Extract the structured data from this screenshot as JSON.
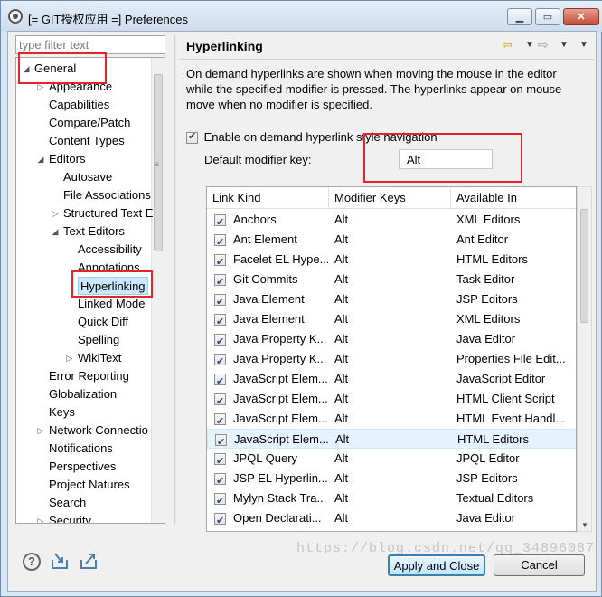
{
  "window": {
    "title": "[= GIT授权应用 =] Preferences"
  },
  "left": {
    "filter_placeholder": "type filter text",
    "tree": [
      {
        "label": "General",
        "level": 0,
        "twisty": "◢"
      },
      {
        "label": "Appearance",
        "level": 1,
        "twisty": "▷"
      },
      {
        "label": "Capabilities",
        "level": 1,
        "twisty": ""
      },
      {
        "label": "Compare/Patch",
        "level": 1,
        "twisty": ""
      },
      {
        "label": "Content Types",
        "level": 1,
        "twisty": ""
      },
      {
        "label": "Editors",
        "level": 1,
        "twisty": "◢"
      },
      {
        "label": "Autosave",
        "level": 2,
        "twisty": ""
      },
      {
        "label": "File Associations",
        "level": 2,
        "twisty": ""
      },
      {
        "label": "Structured Text E",
        "level": 2,
        "twisty": "▷"
      },
      {
        "label": "Text Editors",
        "level": 2,
        "twisty": "◢"
      },
      {
        "label": "Accessibility",
        "level": 3,
        "twisty": ""
      },
      {
        "label": "Annotations",
        "level": 3,
        "twisty": ""
      },
      {
        "label": "Hyperlinking",
        "level": 3,
        "twisty": "",
        "selected": true
      },
      {
        "label": "Linked Mode",
        "level": 3,
        "twisty": ""
      },
      {
        "label": "Quick Diff",
        "level": 3,
        "twisty": ""
      },
      {
        "label": "Spelling",
        "level": 3,
        "twisty": ""
      },
      {
        "label": "WikiText",
        "level": 3,
        "twisty": "▷"
      },
      {
        "label": "Error Reporting",
        "level": 1,
        "twisty": ""
      },
      {
        "label": "Globalization",
        "level": 1,
        "twisty": ""
      },
      {
        "label": "Keys",
        "level": 1,
        "twisty": ""
      },
      {
        "label": "Network Connectio",
        "level": 1,
        "twisty": "▷"
      },
      {
        "label": "Notifications",
        "level": 1,
        "twisty": ""
      },
      {
        "label": "Perspectives",
        "level": 1,
        "twisty": ""
      },
      {
        "label": "Project Natures",
        "level": 1,
        "twisty": ""
      },
      {
        "label": "Search",
        "level": 1,
        "twisty": ""
      },
      {
        "label": "Security",
        "level": 1,
        "twisty": "▷"
      }
    ]
  },
  "page": {
    "title": "Hyperlinking",
    "description": "On demand hyperlinks are shown when moving the mouse in the editor while the specified modifier is pressed. The hyperlinks appear on mouse move when no modifier is specified.",
    "enable_label": "Enable on demand hyperlink style navigation",
    "enable_checked": true,
    "modifier_label": "Default modifier key:",
    "modifier_value": "Alt",
    "columns": [
      "Link Kind",
      "Modifier Keys",
      "Available In"
    ],
    "rows": [
      {
        "kind": "Anchors",
        "mod": "Alt",
        "in": "XML Editors"
      },
      {
        "kind": "Ant Element",
        "mod": "Alt",
        "in": "Ant Editor"
      },
      {
        "kind": "Facelet EL Hype...",
        "mod": "Alt",
        "in": "HTML Editors"
      },
      {
        "kind": "Git Commits",
        "mod": "Alt",
        "in": "Task Editor"
      },
      {
        "kind": "Java Element",
        "mod": "Alt",
        "in": "JSP Editors"
      },
      {
        "kind": "Java Element",
        "mod": "Alt",
        "in": "XML Editors"
      },
      {
        "kind": "Java Property K...",
        "mod": "Alt",
        "in": "Java Editor"
      },
      {
        "kind": "Java Property K...",
        "mod": "Alt",
        "in": "Properties File Edit..."
      },
      {
        "kind": "JavaScript Elem...",
        "mod": "Alt",
        "in": "JavaScript Editor"
      },
      {
        "kind": "JavaScript Elem...",
        "mod": "Alt",
        "in": "HTML Client Script"
      },
      {
        "kind": "JavaScript Elem...",
        "mod": "Alt",
        "in": "HTML Event Handl..."
      },
      {
        "kind": "JavaScript Elem...",
        "mod": "Alt",
        "in": "HTML Editors",
        "selected": true
      },
      {
        "kind": "JPQL Query",
        "mod": "Alt",
        "in": "JPQL Editor"
      },
      {
        "kind": "JSP EL Hyperlin...",
        "mod": "Alt",
        "in": "JSP Editors"
      },
      {
        "kind": "Mylyn Stack Tra...",
        "mod": "Alt",
        "in": "Textual Editors"
      },
      {
        "kind": "Open Declarati...",
        "mod": "Alt",
        "in": "Java Editor"
      }
    ]
  },
  "buttons": {
    "apply_close": "Apply and Close",
    "cancel": "Cancel"
  },
  "watermark": "https://blog.csdn.net/qq_34896087",
  "colors": {
    "highlight_box": "#e2252b",
    "selection": "#cce8ff"
  }
}
